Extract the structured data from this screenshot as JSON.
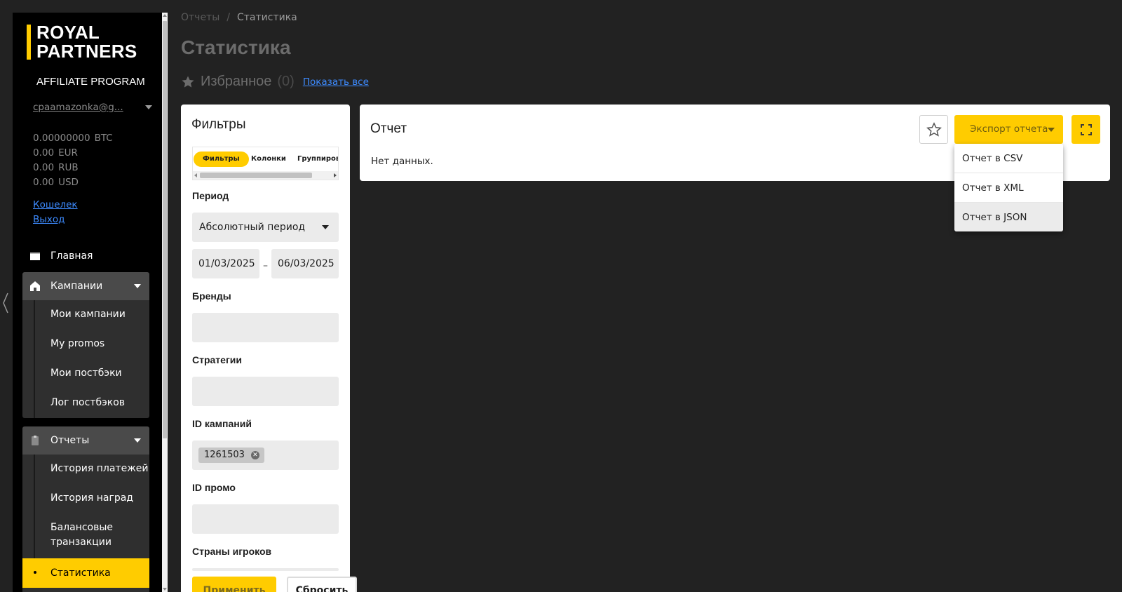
{
  "logo": {
    "line1": "ROYAL",
    "line2": "PARTNERS",
    "subtitle": "AFFILIATE PROGRAM",
    "accent_color": "#ffcc00"
  },
  "user": {
    "email": "cpaamazonka@g..."
  },
  "balances": [
    {
      "amount": "0.00000000",
      "currency": "BTC"
    },
    {
      "amount": "0.00",
      "currency": "EUR"
    },
    {
      "amount": "0.00",
      "currency": "RUB"
    },
    {
      "amount": "0.00",
      "currency": "USD"
    }
  ],
  "account_links": {
    "wallet": "Кошелек",
    "logout": "Выход"
  },
  "nav": {
    "home": {
      "label": "Главная",
      "icon": "window-icon"
    },
    "campaigns": {
      "label": "Кампании",
      "icon": "home-icon",
      "items": [
        "Мои кампании",
        "My promos",
        "Мои постбэки",
        "Лог постбэков"
      ]
    },
    "reports": {
      "label": "Отчеты",
      "icon": "clipboard-icon",
      "items": [
        "История платежей",
        "История наград",
        "Балансовые транзакции",
        "Статистика"
      ],
      "active_item": "Статистика"
    }
  },
  "breadcrumb": {
    "parent": "Отчеты",
    "separator": "/",
    "current": "Статистика"
  },
  "page": {
    "title": "Статистика"
  },
  "favorites": {
    "title": "Избранное",
    "count": "(0)",
    "show_all": "Показать все"
  },
  "filters": {
    "title": "Фильтры",
    "tabs": [
      "Фильтры",
      "Колонки",
      "Группироват"
    ],
    "active_tab": "Фильтры",
    "period_label": "Период",
    "period_value": "Абсолютный период",
    "date_from": "01/03/2025",
    "date_sep": "–",
    "date_to": "06/03/2025",
    "brands_label": "Бренды",
    "strategies_label": "Стратегии",
    "campaign_ids_label": "ID кампаний",
    "campaign_ids": [
      "1261503"
    ],
    "promo_ids_label": "ID промо",
    "countries_label": "Страны игроков",
    "apply": "Применить",
    "reset": "Сбросить"
  },
  "report": {
    "title": "Отчет",
    "empty": "Нет данных.",
    "export_label": "Экспорт отчета",
    "export_options": [
      "Отчет в CSV",
      "Отчет в XML",
      "Отчет в JSON"
    ],
    "hovered_option": "Отчет в JSON"
  }
}
